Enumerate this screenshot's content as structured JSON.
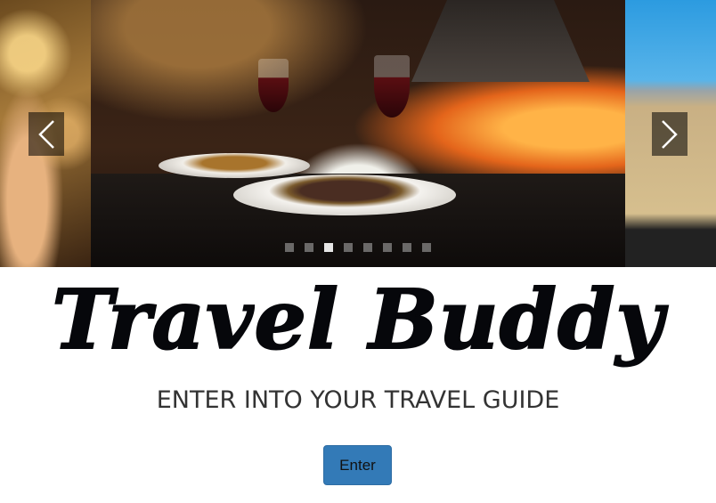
{
  "carousel": {
    "prev_icon": "chevron-left-icon",
    "next_icon": "chevron-right-icon",
    "indicator_count": 8,
    "active_index": 2,
    "slides": [
      "amber-bokeh-hands",
      "restaurant-dinner-fireplace",
      "desert-road-sky"
    ]
  },
  "main": {
    "title": "Travel Buddy",
    "subtitle": "ENTER INTO YOUR TRAVEL GUIDE",
    "enter_label": "Enter"
  },
  "colors": {
    "title": "#06070b",
    "subtitle": "#333333",
    "button_bg": "#337ab7"
  }
}
